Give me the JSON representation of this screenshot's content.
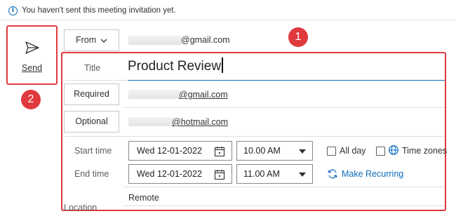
{
  "info_bar": {
    "message": "You haven't sent this meeting invitation yet."
  },
  "send": {
    "label": "Send"
  },
  "badges": {
    "one": "1",
    "two": "2"
  },
  "from": {
    "label": "From",
    "email_suffix": "@gmail.com"
  },
  "title": {
    "label": "Title",
    "value": "Product Review"
  },
  "required": {
    "label": "Required",
    "email_suffix": "@gmail.com"
  },
  "optional": {
    "label": "Optional",
    "email_suffix": "@hotmail.com"
  },
  "start": {
    "label": "Start time",
    "date": "Wed 12-01-2022",
    "time": "10.00 AM"
  },
  "end": {
    "label": "End time",
    "date": "Wed 12-01-2022",
    "time": "11.00 AM"
  },
  "options": {
    "all_day": "All day",
    "time_zones": "Time zones",
    "make_recurring": "Make Recurring"
  },
  "location": {
    "label": "Location",
    "value": "Remote"
  },
  "colors": {
    "accent": "#0f6cbd",
    "highlight": "#e03a3e"
  }
}
